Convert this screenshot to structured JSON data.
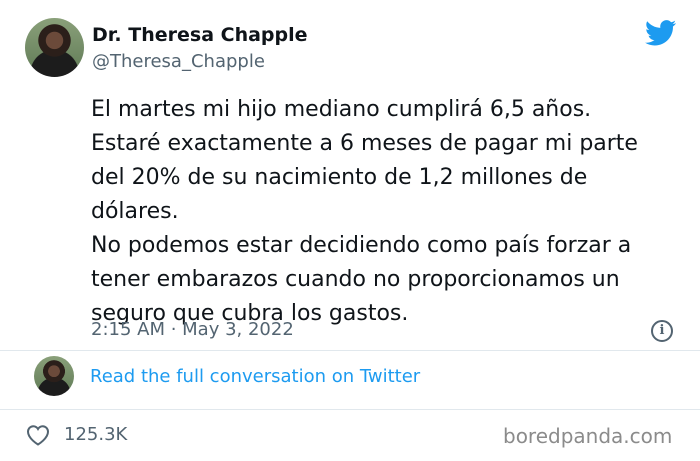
{
  "author": {
    "display_name": "Dr. Theresa Chapple",
    "handle": "@Theresa_Chapple",
    "avatar_icon": "profile-photo"
  },
  "tweet": {
    "text": "El martes mi hijo mediano cumplirá 6,5 años.\nEstaré exactamente a 6 meses de pagar mi parte\ndel 20% de su nacimiento de 1,2 millones de\ndólares.\nNo podemos estar decidiendo como país forzar a\ntener embarazos cuando no proporcionamos un\nseguro que cubra los gastos.",
    "timestamp": "2:15 AM · May 3, 2022"
  },
  "conversation_link": "Read the full conversation on Twitter",
  "likes_count": "125.3K",
  "watermark": "boredpanda.com",
  "colors": {
    "brand": "#1d9bf0",
    "text": "#0f1419",
    "muted": "#536471"
  },
  "icons": [
    "twitter-bird-icon",
    "info-icon",
    "heart-icon"
  ]
}
